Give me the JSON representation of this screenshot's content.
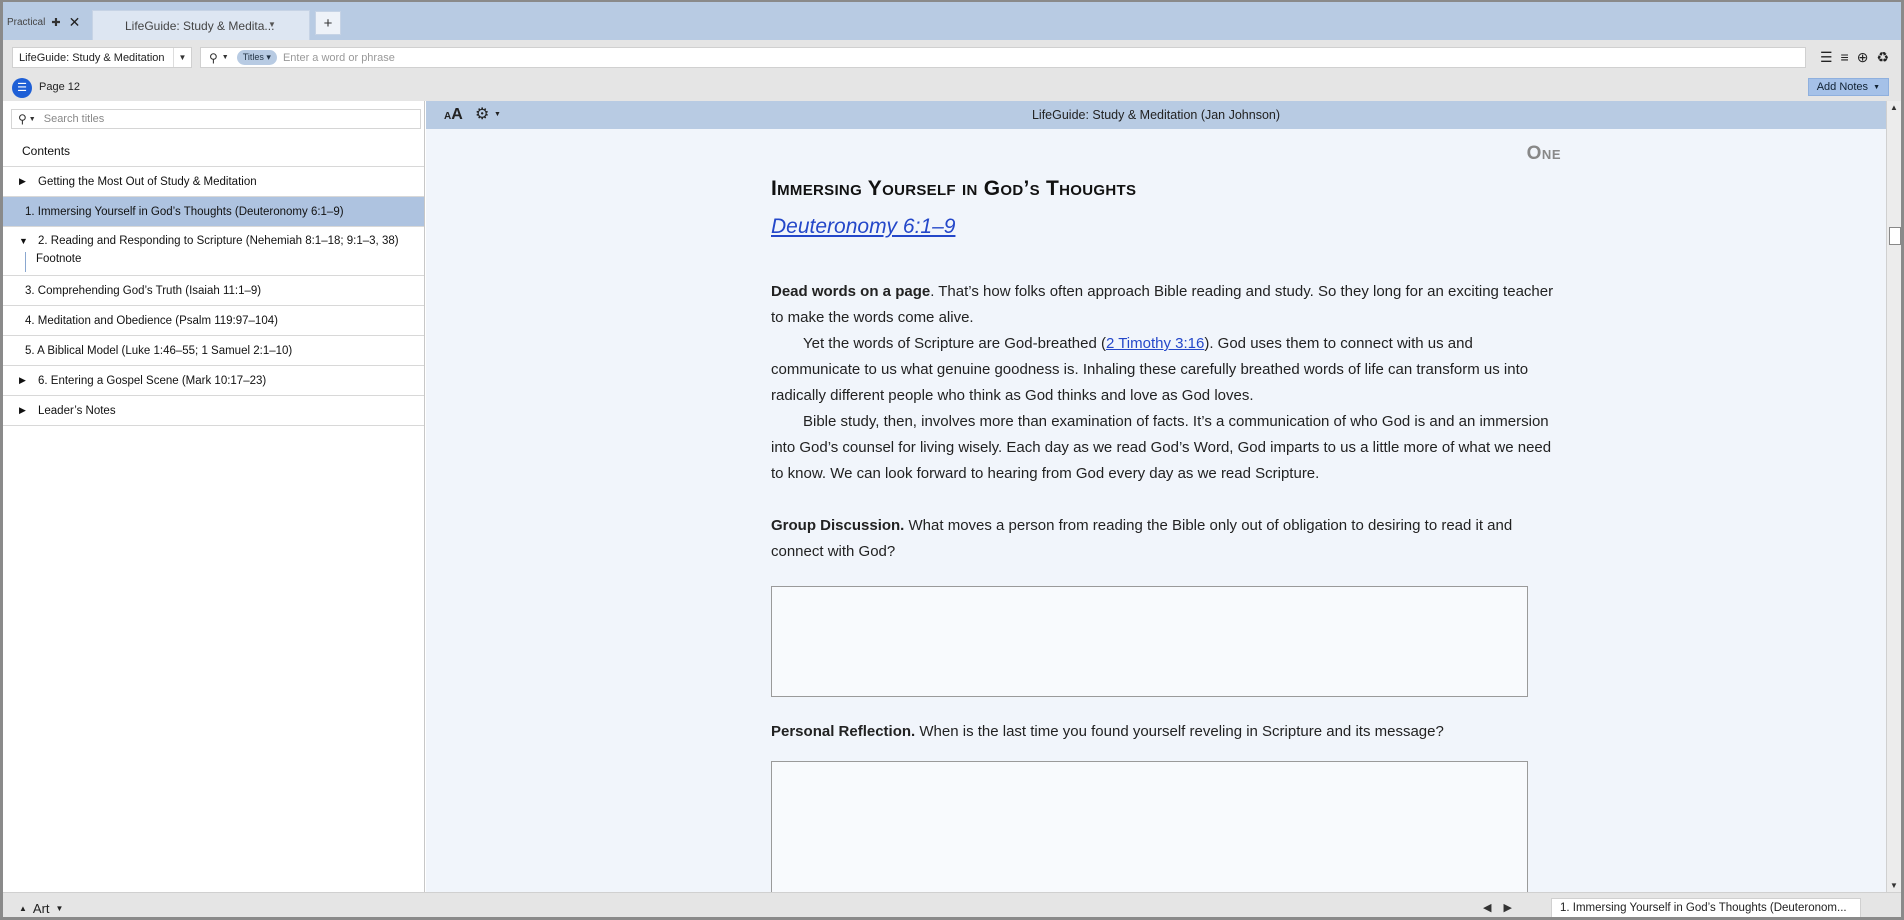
{
  "tabs": {
    "workspace_label": "Practical",
    "document_tab_label": "LifeGuide: Study & Medita...",
    "new_tab": "+"
  },
  "toolbar": {
    "resource_name": "LifeGuide: Study & Meditation",
    "search_scope": "Titles",
    "search_placeholder": "Enter a word or phrase"
  },
  "pagebar": {
    "page_label": "Page 12",
    "add_notes_label": "Add Notes"
  },
  "sidebar": {
    "search_placeholder": "Search titles",
    "contents_label": "Contents",
    "items": [
      {
        "label": "Getting the Most Out of Study & Meditation",
        "expander": "collapsed",
        "selected": false
      },
      {
        "label": "1. Immersing Yourself in God’s Thoughts (Deuteronomy 6:1–9)",
        "expander": "none",
        "selected": true
      },
      {
        "label": "2. Reading and Responding to Scripture (Nehemiah 8:1–18; 9:1–3, 38)",
        "expander": "expanded",
        "selected": false,
        "children": [
          {
            "label": "Footnote"
          }
        ]
      },
      {
        "label": "3. Comprehending God’s Truth (Isaiah 11:1–9)",
        "expander": "none",
        "selected": false
      },
      {
        "label": "4. Meditation and Obedience (Psalm 119:97–104)",
        "expander": "none",
        "selected": false
      },
      {
        "label": "5. A Biblical Model (Luke 1:46–55; 1 Samuel 2:1–10)",
        "expander": "none",
        "selected": false
      },
      {
        "label": "6. Entering a Gospel Scene (Mark 10:17–23)",
        "expander": "collapsed",
        "selected": false
      },
      {
        "label": "Leader’s Notes",
        "expander": "collapsed",
        "selected": false
      }
    ]
  },
  "reader": {
    "title": "LifeGuide: Study & Meditation (Jan Johnson)",
    "chapter_number": "One",
    "chapter_title": "Immersing Yourself in God’s Thoughts",
    "chapter_reference": "Deuteronomy 6:1–9",
    "p1_bold": "Dead words on a page",
    "p1_rest": ". That’s how folks often approach Bible reading and study. So they long for an exciting teacher to make the words come alive.",
    "p2_before": "Yet the words of Scripture are God-breathed (",
    "p2_link": "2 Timothy 3:16",
    "p2_after": "). God uses them to connect with us and communicate to us what genuine goodness is. Inhaling these carefully breathed words of life can transform us into radically different people who think as God thinks and love as God loves.",
    "p3": "Bible study, then, involves more than examination of facts. It’s a communication of who God is and an immersion into God’s counsel for living wisely. Each day as we read God’s Word, God imparts to us a little more of what we need to know. We can look forward to hearing from God every day as we read Scripture.",
    "group_bold": "Group Discussion.",
    "group_rest": " What moves a person from reading the Bible only out of obligation to desiring to read it and connect with God?",
    "personal_bold": "Personal Reflection.",
    "personal_rest": " When is the last time you found yourself reveling in Scripture and its message?"
  },
  "statusbar": {
    "art_label": "Art",
    "location": "1. Immersing Yourself in God’s Thoughts (Deuteronom..."
  },
  "icons": {
    "workspace": "layout-icon",
    "close": "close-icon",
    "search": "search-icon",
    "toc": "list-icon",
    "font_size": "text-size-icon",
    "settings": "gear-icon"
  },
  "colors": {
    "accent": "#1e5fd6",
    "tab_bar": "#b8cbe3",
    "selected_row": "#aec3e0",
    "link": "#2447c9",
    "reader_bg": "#f1f5fb"
  }
}
